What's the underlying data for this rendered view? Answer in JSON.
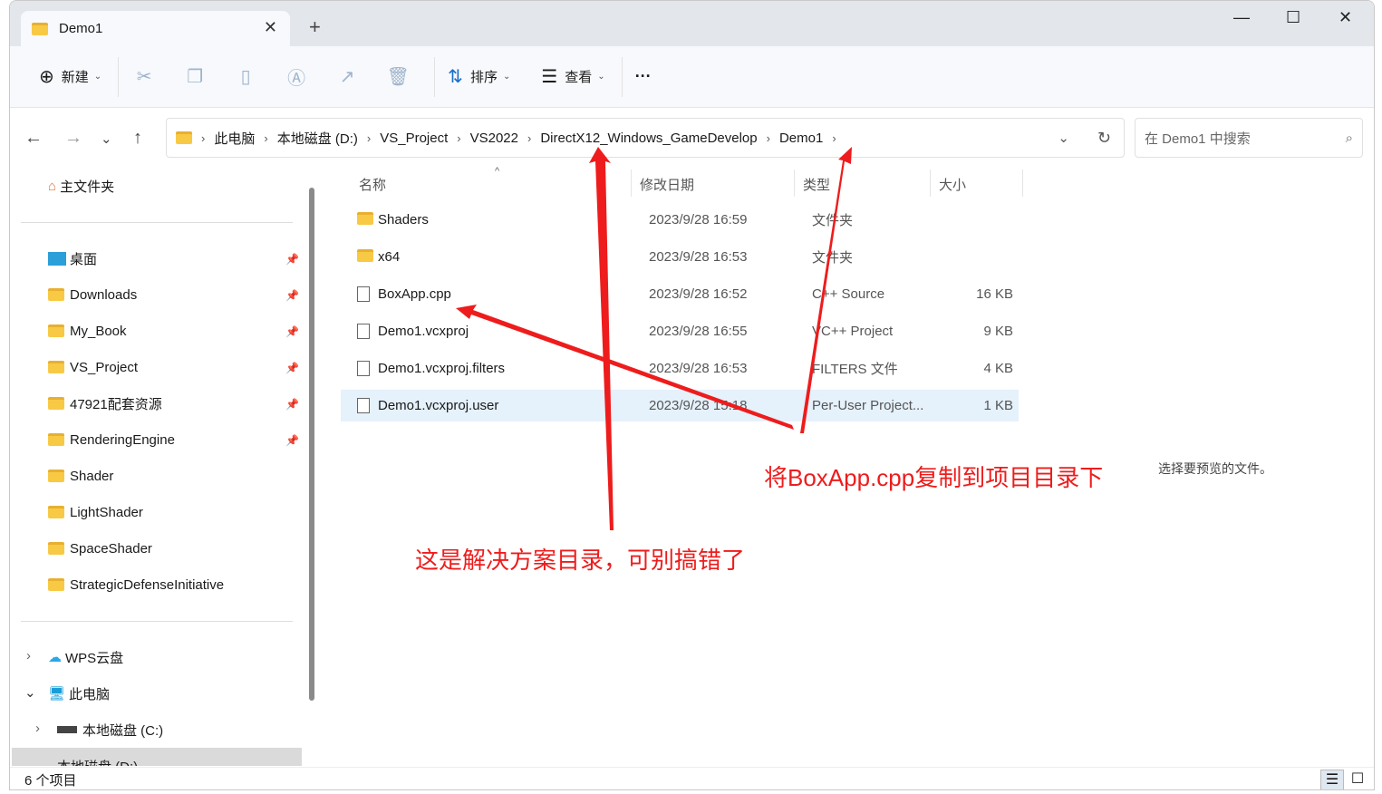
{
  "tab": {
    "title": "Demo1"
  },
  "toolbar": {
    "new": "新建",
    "sort": "排序",
    "view": "查看",
    "more": "···"
  },
  "address": {
    "crumbs": [
      "此电脑",
      "本地磁盘 (D:)",
      "VS_Project",
      "VS2022",
      "DirectX12_Windows_GameDevelop",
      "Demo1"
    ]
  },
  "search": {
    "placeholder": "在 Demo1 中搜索"
  },
  "sidebar": {
    "home": "主文件夹",
    "pinned": [
      "桌面",
      "Downloads",
      "My_Book",
      "VS_Project",
      "47921配套资源",
      "RenderingEngine"
    ],
    "folders": [
      "Shader",
      "LightShader",
      "SpaceShader",
      "StrategicDefenseInitiative"
    ],
    "wps": "WPS云盘",
    "pc": "此电脑",
    "drive_c": "本地磁盘 (C:)",
    "drive_d": "本地磁盘 (D:)"
  },
  "columns": {
    "name": "名称",
    "date": "修改日期",
    "type": "类型",
    "size": "大小"
  },
  "files": [
    {
      "name": "Shaders",
      "date": "2023/9/28 16:59",
      "type": "文件夹",
      "size": "",
      "icon": "folder-icon"
    },
    {
      "name": "x64",
      "date": "2023/9/28 16:53",
      "type": "文件夹",
      "size": "",
      "icon": "folder-icon"
    },
    {
      "name": "BoxApp.cpp",
      "date": "2023/9/28 16:52",
      "type": "C++ Source",
      "size": "16 KB",
      "icon": "cpp-file-icon"
    },
    {
      "name": "Demo1.vcxproj",
      "date": "2023/9/28 16:55",
      "type": "VC++ Project",
      "size": "9 KB",
      "icon": "vcxproj-file-icon"
    },
    {
      "name": "Demo1.vcxproj.filters",
      "date": "2023/9/28 16:53",
      "type": "FILTERS 文件",
      "size": "4 KB",
      "icon": "file-icon"
    },
    {
      "name": "Demo1.vcxproj.user",
      "date": "2023/9/28 15:18",
      "type": "Per-User Project...",
      "size": "1 KB",
      "icon": "vs-user-file-icon"
    }
  ],
  "preview": {
    "text": "选择要预览的文件。"
  },
  "status": {
    "count": "6 个项目"
  },
  "annotations": {
    "copy": "将BoxApp.cpp复制到项目目录下",
    "solution": "这是解决方案目录，可别搞错了",
    "color": "#ee1c1c"
  }
}
